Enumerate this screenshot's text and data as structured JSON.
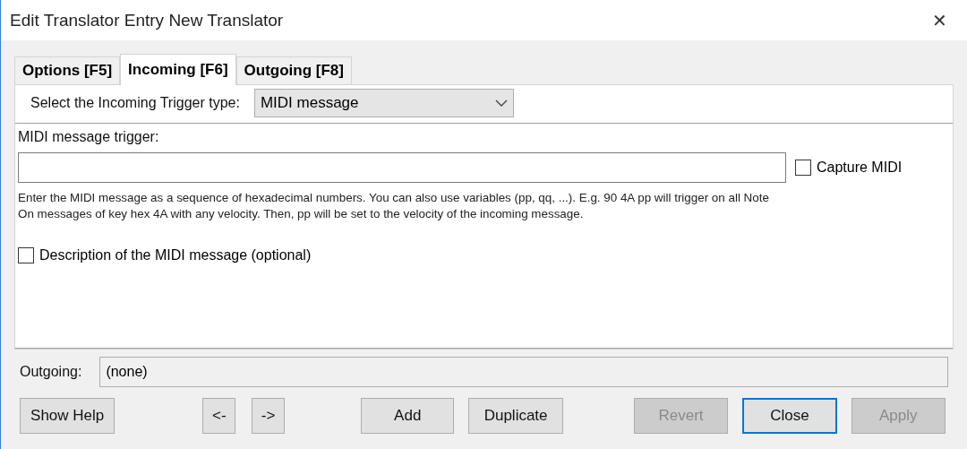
{
  "window": {
    "title": "Edit Translator Entry New Translator",
    "close": "✕"
  },
  "tabs": [
    {
      "label": "Options [F5]",
      "selected": false
    },
    {
      "label": "Incoming [F6]",
      "selected": true
    },
    {
      "label": "Outgoing [F8]",
      "selected": false
    }
  ],
  "trigger_type": {
    "label": "Select the Incoming Trigger type:",
    "value": "MIDI message"
  },
  "trigger": {
    "label": "MIDI message trigger:",
    "capture": {
      "label": "Capture MIDI",
      "checked": false
    }
  },
  "help_text": "Enter the MIDI message as a sequence of hexadecimal numbers. You can also use variables (pp, qq, ...). E.g. 90 4A pp will trigger on all Note On messages of key hex 4A with any velocity. Then, pp will be set to the velocity of the incoming message.",
  "description": {
    "label": "Description of the MIDI message (optional)",
    "checked": false
  },
  "outgoing": {
    "label": "Outgoing:",
    "value": "(none)"
  },
  "buttons": [
    {
      "label": "Show Help",
      "disabled": false,
      "default": false
    },
    {
      "label": "<-",
      "disabled": false,
      "default": false
    },
    {
      "label": "->",
      "disabled": false,
      "default": false
    },
    {
      "label": "Add",
      "disabled": false,
      "default": false
    },
    {
      "label": "Duplicate",
      "disabled": false,
      "default": false
    },
    {
      "label": "Revert",
      "disabled": true,
      "default": false
    },
    {
      "label": "Close",
      "disabled": false,
      "default": true
    },
    {
      "label": "Apply",
      "disabled": true,
      "default": false
    }
  ]
}
